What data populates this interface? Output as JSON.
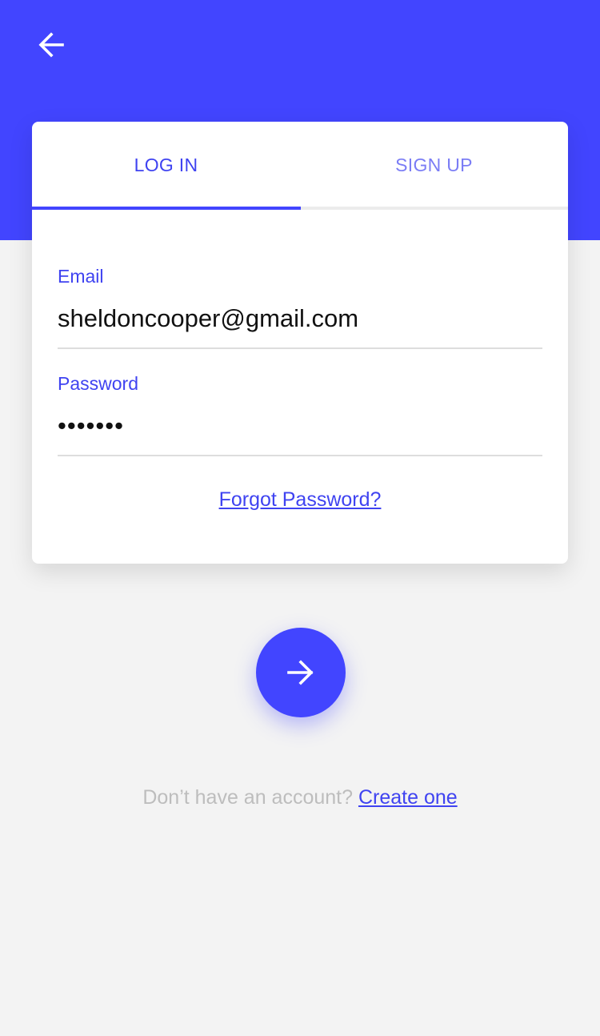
{
  "header": {
    "back_icon": "arrow-left-icon",
    "color": "#4245ff"
  },
  "tabs": [
    {
      "label": "LOG IN",
      "active": true
    },
    {
      "label": "SIGN UP",
      "active": false
    }
  ],
  "form": {
    "email": {
      "label": "Email",
      "value": "sheldoncooper@gmail.com"
    },
    "password": {
      "label": "Password",
      "value": "•••••••"
    },
    "forgot_password": "Forgot Password?"
  },
  "submit": {
    "icon": "arrow-right-icon"
  },
  "footer": {
    "prompt": "Don’t have an account?",
    "create_link": "Create one"
  },
  "colors": {
    "accent": "#4245ff",
    "background": "#f3f3f3",
    "card": "#ffffff",
    "muted_text": "#bdbdbd"
  }
}
